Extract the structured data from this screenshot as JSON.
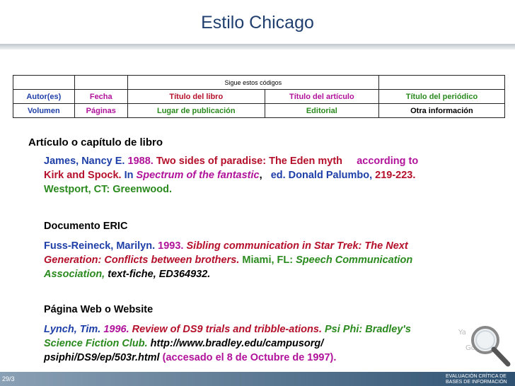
{
  "title": "Estilo Chicago",
  "codes": {
    "header": "Sigue estos códigos",
    "row1": [
      "Autor(es)",
      "Fecha",
      "Título del libro",
      "Título del artículo",
      "Título del periódico"
    ],
    "row2": [
      "Volumen",
      "Páginas",
      "Lugar de publicación",
      "Editorial",
      "Otra información"
    ]
  },
  "section_heading": "Artículo o capítulo de libro",
  "ex1": {
    "author": "James, Nancy E.",
    "year": "1988.",
    "article": "Two sides of paradise: The Eden myth",
    "article2": "according to",
    "article3": "Kirk and Spock.",
    "in": "In",
    "book": "Spectrum of the fantastic",
    "comma": ",",
    "editor": "ed. Donald Palumbo,",
    "pages": "219-223.",
    "place": "Westport, CT:",
    "publisher": "Greenwood."
  },
  "ex2": {
    "heading": "Documento ERIC",
    "author": "Fuss-Reineck, Marilyn.",
    "year": "1993.",
    "title1": "Sibling communication in Star Trek: The Next",
    "title2": "Generation: Conflicts between brothers.",
    "place": "Miami, FL:",
    "publisher1": "Speech Communication",
    "publisher2": "Association,",
    "other": "text-fiche, ED364932."
  },
  "ex3": {
    "heading": "Página Web o Website",
    "author": "Lynch, Tim.",
    "year": "1996.",
    "title": "Review of DS9 trials and tribble-ations.",
    "journal1": "Psi Phi: Bradley's",
    "journal2": "Science Fiction Club.",
    "url1": "http://www.bradley.edu/campusorg/",
    "url2": "psiphi/DS9/ep/503r.html",
    "accessed": "(accesado el 8 de Octubre de 1997)."
  },
  "slide_number": "29/3",
  "footer_logo_text": [
    "EVALUACIÓN CRÍTICA DE",
    "BASES DE INFORMACIÓN"
  ],
  "colors": {
    "author": "#1f3fa8",
    "date": "#b0129a",
    "book_title": "#b5102b",
    "article_title": "#b0129a",
    "journal_title": "#2a8a1e",
    "title_text": "#1f3f6f"
  }
}
